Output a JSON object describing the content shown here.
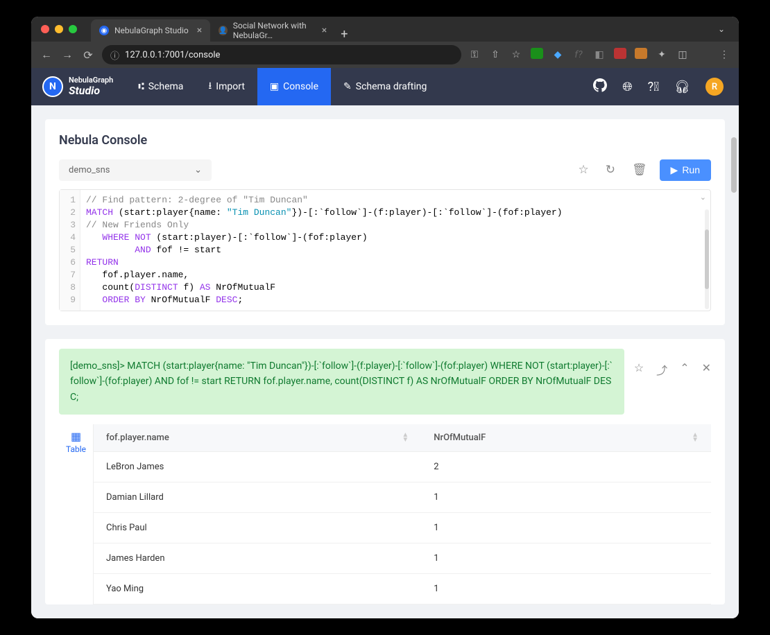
{
  "browser": {
    "tabs": [
      {
        "title": "NebulaGraph Studio",
        "active": true
      },
      {
        "title": "Social Network with NebulaGr…",
        "active": false
      }
    ],
    "url": "127.0.0.1:7001/console"
  },
  "header": {
    "logo_top": "NebulaGraph",
    "logo_bottom": "Studio",
    "menu": {
      "schema": "Schema",
      "import": "Import",
      "console": "Console",
      "drafting": "Schema drafting"
    },
    "user_initial": "R"
  },
  "console": {
    "title": "Nebula Console",
    "db_selected": "demo_sns",
    "run_label": "Run",
    "code_lines": [
      {
        "n": "1",
        "html": "<span class='cm'>// Find pattern: 2-degree of \"Tim Duncan\"</span>"
      },
      {
        "n": "2",
        "html": "<span class='kw'>MATCH</span> (start:player{name: <span class='op'>\"Tim Duncan\"</span>})-[:`follow`]-(f:player)-[:`follow`]-(fof:player)"
      },
      {
        "n": "3",
        "html": "<span class='cm'>// New Friends Only</span>"
      },
      {
        "n": "4",
        "html": "   <span class='kw'>WHERE NOT</span> (start:player)-[:`follow`]-(fof:player)"
      },
      {
        "n": "5",
        "html": "         <span class='kw'>AND</span> fof != start"
      },
      {
        "n": "6",
        "html": "<span class='kw'>RETURN</span>"
      },
      {
        "n": "7",
        "html": "   fof.player.name,"
      },
      {
        "n": "8",
        "html": "   count(<span class='kw'>DISTINCT</span> f) <span class='kw'>AS</span> NrOfMutualF"
      },
      {
        "n": "9",
        "html": "   <span class='kw'>ORDER BY</span> NrOfMutualF <span class='kw'>DESC</span>;"
      }
    ]
  },
  "result": {
    "query_echo": "[demo_sns]> MATCH (start:player{name: \"Tim Duncan\"})-[:`follow`]-(f:player)-[:`follow`]-(fof:player) WHERE NOT (start:player)-[:`follow`]-(fof:player) AND fof != start RETURN fof.player.name, count(DISTINCT f) AS NrOfMutualF ORDER BY NrOfMutualF DESC;",
    "tab_table": "Table",
    "columns": {
      "c0": "fof.player.name",
      "c1": "NrOfMutualF"
    },
    "rows": [
      {
        "name": "LeBron James",
        "n": "2"
      },
      {
        "name": "Damian Lillard",
        "n": "1"
      },
      {
        "name": "Chris Paul",
        "n": "1"
      },
      {
        "name": "James Harden",
        "n": "1"
      },
      {
        "name": "Yao Ming",
        "n": "1"
      }
    ]
  },
  "chart_data": {
    "type": "table",
    "columns": [
      "fof.player.name",
      "NrOfMutualF"
    ],
    "rows": [
      [
        "LeBron James",
        2
      ],
      [
        "Damian Lillard",
        1
      ],
      [
        "Chris Paul",
        1
      ],
      [
        "James Harden",
        1
      ],
      [
        "Yao Ming",
        1
      ]
    ]
  }
}
